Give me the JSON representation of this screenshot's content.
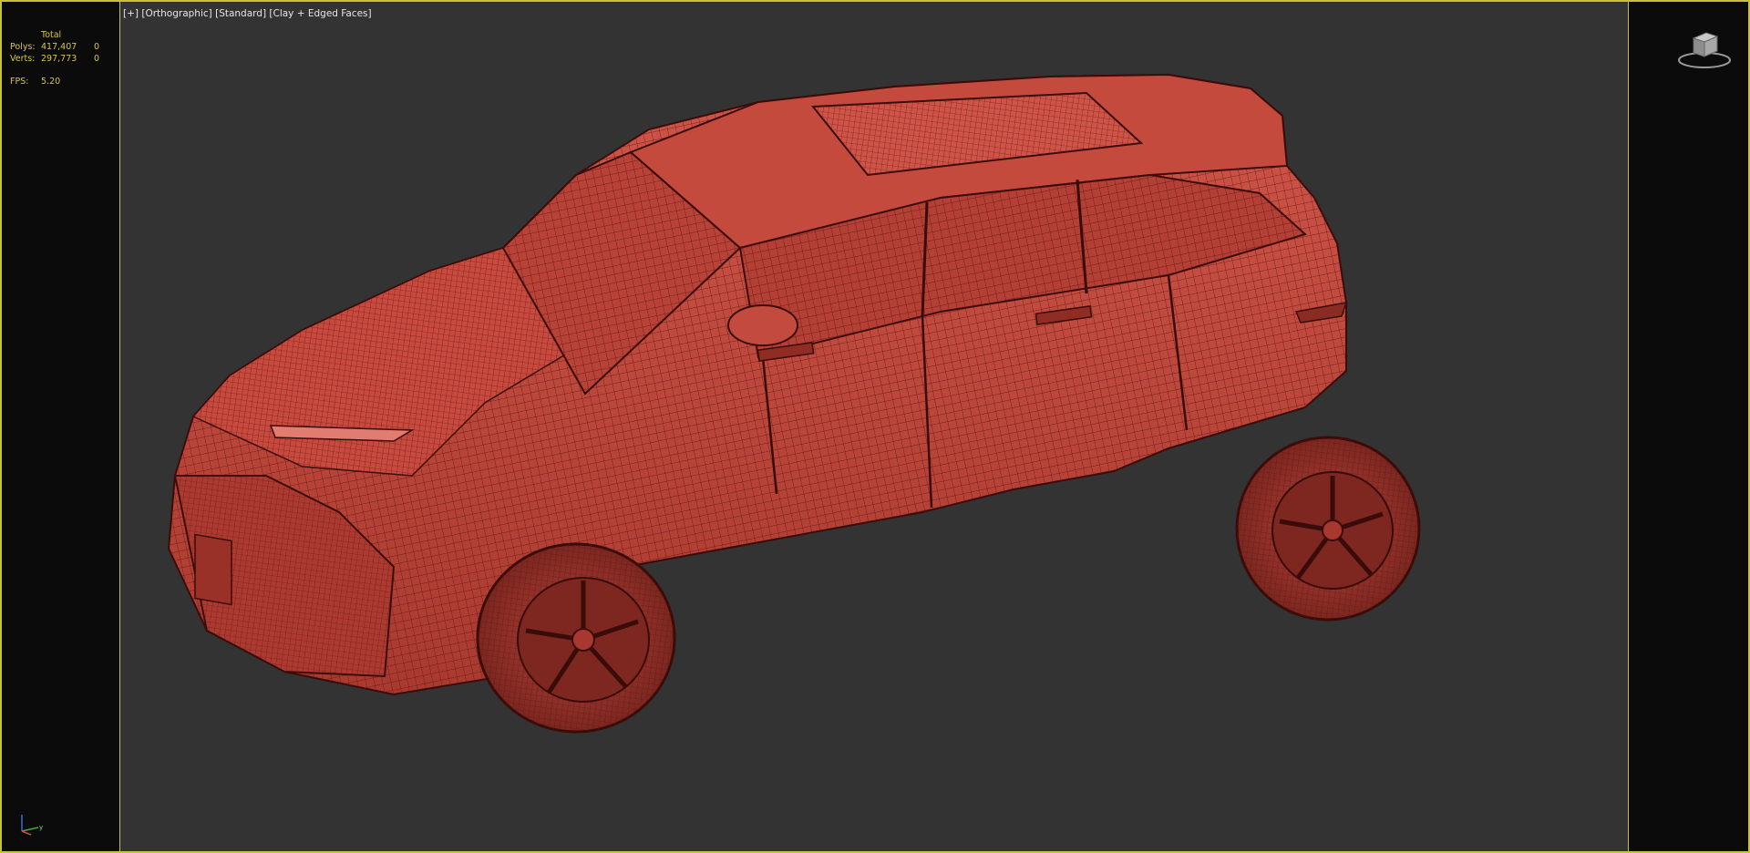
{
  "viewport": {
    "labels": [
      "[+]",
      "[Orthographic]",
      "[Standard]",
      "[Clay + Edged Faces]"
    ]
  },
  "stats": {
    "header": "Total",
    "polys_label": "Polys:",
    "polys_total": "417,407",
    "polys_selected": "0",
    "verts_label": "Verts:",
    "verts_total": "297,773",
    "verts_selected": "0",
    "fps_label": "FPS:",
    "fps_value": "5.20"
  },
  "colors": {
    "viewport_bg": "#333333",
    "clay": "#c24a3f",
    "stats_text": "#d8c640",
    "active_border": "#c8c23a"
  },
  "icons": {
    "viewcube": "viewcube-icon",
    "axis": "axis-tripod-icon"
  },
  "scene": {
    "object": "car-wireframe-model"
  }
}
